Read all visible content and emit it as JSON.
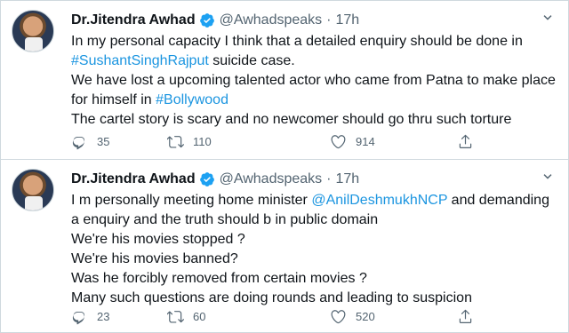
{
  "tweets": [
    {
      "name": "Dr.Jitendra Awhad",
      "handle": "@Awhadspeaks",
      "separator": "·",
      "time": "17h",
      "lines": [
        {
          "parts": [
            {
              "text": "In my personal capacity I think that a detailed enquiry should be done in",
              "link": false
            }
          ]
        },
        {
          "parts": [
            {
              "text": "#SushantSinghRajput",
              "link": true
            },
            {
              "text": " suicide case.",
              "link": false
            }
          ]
        },
        {
          "parts": [
            {
              "text": "We have lost a upcoming talented actor who came from Patna to make place",
              "link": false
            }
          ]
        },
        {
          "parts": [
            {
              "text": "for himself in ",
              "link": false
            },
            {
              "text": "#Bollywood",
              "link": true
            }
          ]
        },
        {
          "parts": [
            {
              "text": "The cartel story is scary and no newcomer should go thru such torture",
              "link": false
            }
          ]
        }
      ],
      "replies": "35",
      "retweets": "110",
      "likes": "914"
    },
    {
      "name": "Dr.Jitendra Awhad",
      "handle": "@Awhadspeaks",
      "separator": "·",
      "time": "17h",
      "lines": [
        {
          "parts": [
            {
              "text": "I m personally meeting home minister ",
              "link": false
            },
            {
              "text": "@AnilDeshmukhNCP",
              "link": true
            },
            {
              "text": " and demanding",
              "link": false
            }
          ]
        },
        {
          "parts": [
            {
              "text": "a enquiry and the truth should b in public domain",
              "link": false
            }
          ]
        },
        {
          "parts": [
            {
              "text": "We're his movies stopped ?",
              "link": false
            }
          ]
        },
        {
          "parts": [
            {
              "text": "We're his movies banned?",
              "link": false
            }
          ]
        },
        {
          "parts": [
            {
              "text": "Was he forcibly removed from certain movies ?",
              "link": false
            }
          ]
        },
        {
          "parts": [
            {
              "text": "Many such questions are doing rounds and leading to suspicion",
              "link": false
            }
          ]
        }
      ],
      "replies": "23",
      "retweets": "60",
      "likes": "520"
    }
  ],
  "icons": {
    "verified": "verified-badge-icon",
    "caret": "chevron-down-icon",
    "reply": "reply-icon",
    "retweet": "retweet-icon",
    "like": "heart-icon",
    "share": "share-icon"
  },
  "colors": {
    "link": "#1b95e0",
    "text": "#0f1419",
    "muted": "#536471",
    "verified": "#1da1f2",
    "border": "#cfd9de"
  }
}
